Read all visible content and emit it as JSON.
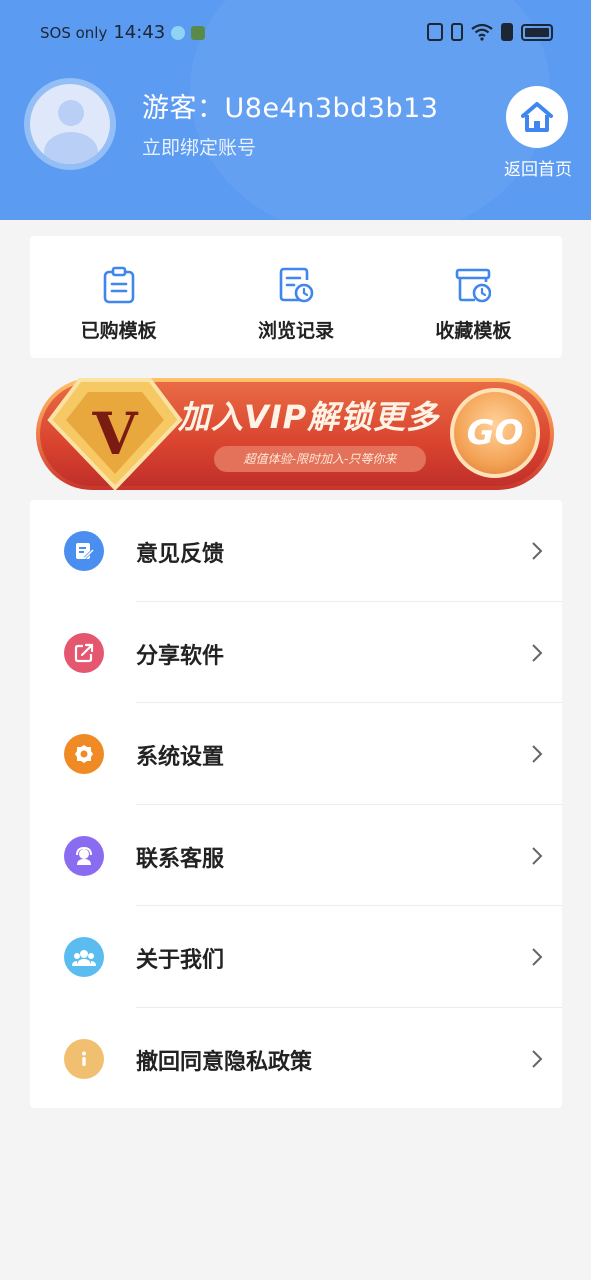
{
  "status_bar": {
    "carrier": "SOS only",
    "time": "14:43"
  },
  "profile": {
    "username": "游客：U8e4n3bd3b13",
    "bind_account": "立即绑定账号",
    "home_label": "返回首页"
  },
  "quick_actions": [
    {
      "label": "已购模板",
      "icon": "clipboard-icon"
    },
    {
      "label": "浏览记录",
      "icon": "history-doc-icon"
    },
    {
      "label": "收藏模板",
      "icon": "archive-clock-icon"
    }
  ],
  "vip_banner": {
    "badge": "V",
    "title": "加入VIP解锁更多",
    "subtitle": "超值体验-限时加入-只等你来",
    "go": "GO"
  },
  "menu": [
    {
      "label": "意见反馈",
      "icon": "feedback-icon",
      "color": "#4a8ef0"
    },
    {
      "label": "分享软件",
      "icon": "share-icon",
      "color": "#e5566f"
    },
    {
      "label": "系统设置",
      "icon": "gear-icon",
      "color": "#f08a24"
    },
    {
      "label": "联系客服",
      "icon": "headset-icon",
      "color": "#8a6cf0"
    },
    {
      "label": "关于我们",
      "icon": "group-icon",
      "color": "#5bbcf0"
    },
    {
      "label": "撤回同意隐私政策",
      "icon": "info-icon",
      "color": "#f0c070"
    }
  ],
  "colors": {
    "header": "#5b9bf2",
    "background": "#f4f4f4"
  }
}
